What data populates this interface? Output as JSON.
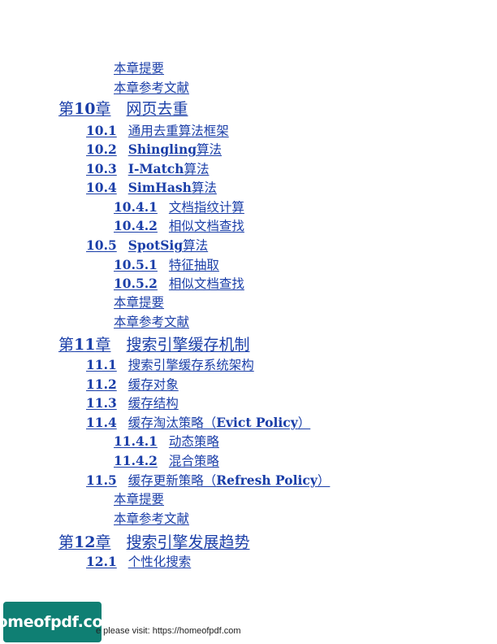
{
  "toc": [
    {
      "level": 3,
      "num": "",
      "title": "本章提要"
    },
    {
      "level": 3,
      "num": "",
      "title": "本章参考文献"
    },
    {
      "level": 1,
      "prefix": "第",
      "num": "10",
      "suffix": "章",
      "title": "网页去重"
    },
    {
      "level": 2,
      "num": "10.1",
      "title": "通用去重算法框架"
    },
    {
      "level": 2,
      "num": "10.2",
      "title_bold": "Shingling",
      "title": "算法"
    },
    {
      "level": 2,
      "num": "10.3",
      "title_bold": "I-Match",
      "title": "算法"
    },
    {
      "level": 2,
      "num": "10.4",
      "title_bold": "SimHash",
      "title": "算法"
    },
    {
      "level": 3,
      "num": "10.4.1",
      "title": "文档指纹计算"
    },
    {
      "level": 3,
      "num": "10.4.2",
      "title": "相似文档查找"
    },
    {
      "level": 2,
      "num": "10.5",
      "title_bold": "SpotSig",
      "title": "算法"
    },
    {
      "level": 3,
      "num": "10.5.1",
      "title": "特征抽取"
    },
    {
      "level": 3,
      "num": "10.5.2",
      "title": "相似文档查找"
    },
    {
      "level": 3,
      "num": "",
      "title": "本章提要"
    },
    {
      "level": 3,
      "num": "",
      "title": "本章参考文献"
    },
    {
      "level": 1,
      "prefix": "第",
      "num": "11",
      "suffix": "章",
      "title": "搜索引擎缓存机制"
    },
    {
      "level": 2,
      "num": "11.1",
      "title": "搜索引擎缓存系统架构"
    },
    {
      "level": 2,
      "num": "11.2",
      "title": "缓存对象"
    },
    {
      "level": 2,
      "num": "11.3",
      "title": "缓存结构"
    },
    {
      "level": 2,
      "num": "11.4",
      "title": "缓存淘汰策略（",
      "title_bold": "Evict Policy",
      "title_end": "）"
    },
    {
      "level": 3,
      "num": "11.4.1",
      "title": "动态策略"
    },
    {
      "level": 3,
      "num": "11.4.2",
      "title": "混合策略"
    },
    {
      "level": 2,
      "num": "11.5",
      "title": "缓存更新策略（",
      "title_bold": "Refresh Policy",
      "title_end": "）"
    },
    {
      "level": 3,
      "num": "",
      "title": "本章提要"
    },
    {
      "level": 3,
      "num": "",
      "title": "本章参考文献"
    },
    {
      "level": 1,
      "prefix": "第",
      "num": "12",
      "suffix": "章",
      "title": "搜索引擎发展趋势"
    },
    {
      "level": 2,
      "num": "12.1",
      "title": "个性化搜索"
    }
  ],
  "footer": {
    "badge": "homeofpdf.com",
    "text": "e please visit: https://homeofpdf.com"
  }
}
